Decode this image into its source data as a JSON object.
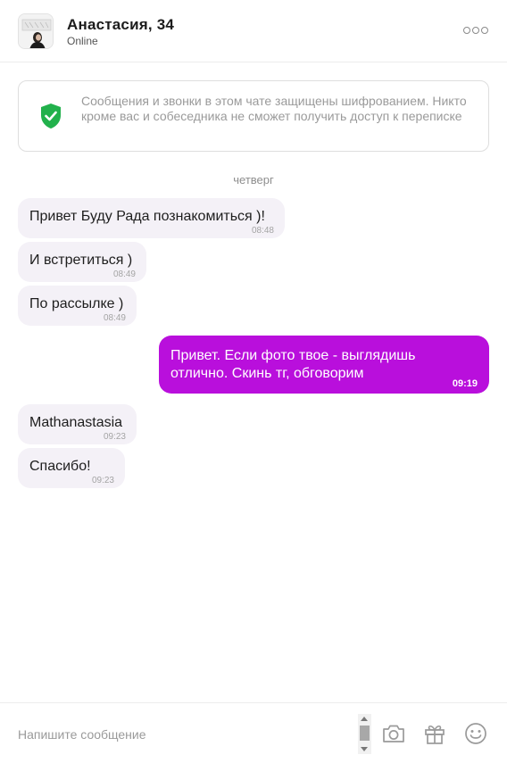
{
  "header": {
    "name": "Анастасия, 34",
    "status": "Online",
    "avatar_icon": "profile-photo",
    "more_icon": "more-dots-icon"
  },
  "notice": {
    "icon": "shield-check-icon",
    "icon_color": "#22b14c",
    "text": "Сообщения и звонки в этом чате защищены шифрованием. Никто кроме вас и собеседника не сможет получить доступ к переписке"
  },
  "day_separator": "четверг",
  "messages": [
    {
      "direction": "in",
      "text": "Привет  Буду Рада познакомиться )!",
      "time": "08:48"
    },
    {
      "direction": "in",
      "text": "И встретиться )",
      "time": "08:49"
    },
    {
      "direction": "in",
      "text": "По рассылке )",
      "time": "08:49"
    },
    {
      "direction": "out",
      "text": "Привет. Если фото твое - выглядишь отлично. Скинь тг, обговорим",
      "time": "09:19"
    },
    {
      "direction": "in",
      "text": "Mathanastasia",
      "time": "09:23"
    },
    {
      "direction": "in",
      "text": "Спасибо!",
      "time": "09:23"
    }
  ],
  "composer": {
    "placeholder": "Напишите сообщение",
    "value": "",
    "tools": [
      "camera-icon",
      "gift-icon",
      "smiley-icon"
    ]
  },
  "colors": {
    "outgoing_bubble": "#b90fdc",
    "incoming_bubble": "#f4f1f7",
    "accent_green": "#22b14c"
  }
}
